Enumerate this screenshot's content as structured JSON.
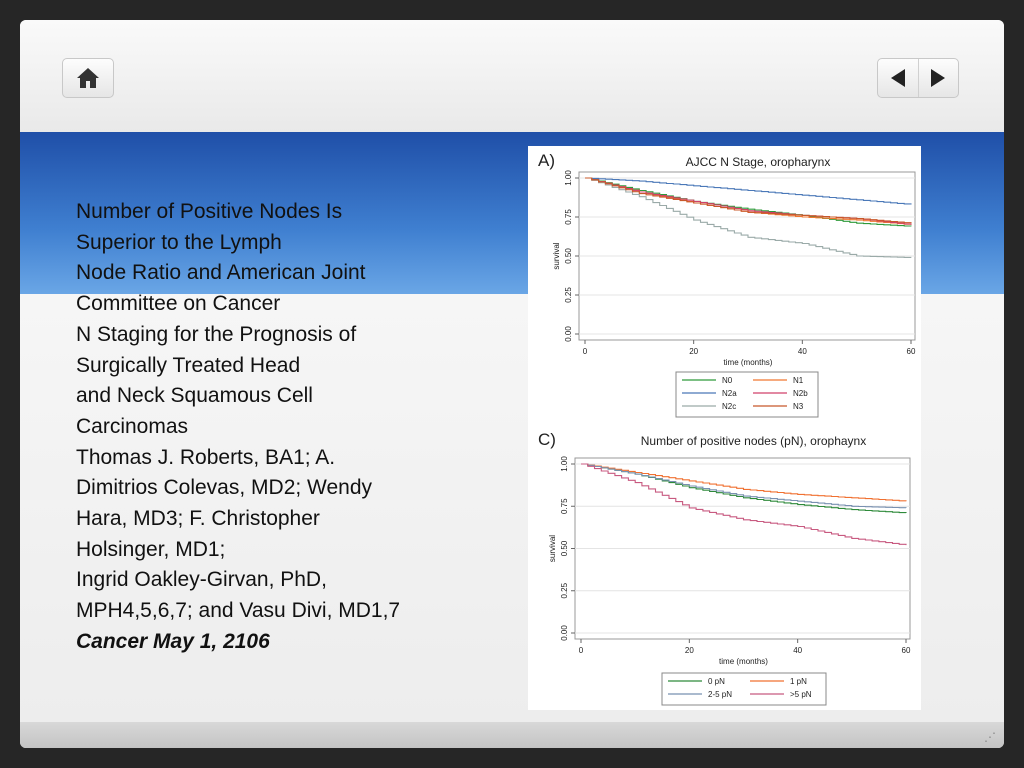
{
  "toolbar": {
    "home_icon": "home-icon",
    "prev_icon": "triangle-left-icon",
    "next_icon": "triangle-right-icon"
  },
  "slide": {
    "title_lines": [
      "Number of Positive Nodes Is",
      "Superior to the Lymph",
      "Node Ratio and American Joint",
      "Committee on Cancer",
      "N Staging for the Prognosis of",
      "Surgically Treated Head",
      "and Neck Squamous Cell",
      "Carcinomas",
      "Thomas J. Roberts, BA1; A.",
      "Dimitrios Colevas, MD2; Wendy",
      "Hara, MD3; F. Christopher",
      "Holsinger, MD1;",
      "Ingrid Oakley-Girvan, PhD,",
      "MPH4,5,6,7; and Vasu Divi, MD1,7"
    ],
    "citation": "Cancer May 1, 2106"
  },
  "chart_data": [
    {
      "panel": "A)",
      "type": "line",
      "title": "AJCC N Stage, oropharynx",
      "xlabel": "time (months)",
      "ylabel": "survival",
      "xlim": [
        0,
        60
      ],
      "ylim": [
        0,
        1
      ],
      "xticks": [
        "0",
        "20",
        "40",
        "60"
      ],
      "yticks": [
        "0.00",
        "0.25",
        "0.50",
        "0.75",
        "1.00"
      ],
      "grid": true,
      "legend": "bottom",
      "x": [
        0,
        10,
        20,
        30,
        40,
        50,
        60
      ],
      "series": [
        {
          "name": "N0",
          "color": "#2e9a3a",
          "values": [
            1,
            0.92,
            0.85,
            0.8,
            0.76,
            0.71,
            0.69
          ]
        },
        {
          "name": "N1",
          "color": "#f07830",
          "values": [
            1,
            0.91,
            0.84,
            0.78,
            0.75,
            0.73,
            0.7
          ]
        },
        {
          "name": "N2a",
          "color": "#4a78b8",
          "values": [
            1,
            0.98,
            0.95,
            0.92,
            0.89,
            0.86,
            0.83
          ]
        },
        {
          "name": "N2b",
          "color": "#d0406a",
          "values": [
            1,
            0.91,
            0.85,
            0.79,
            0.76,
            0.74,
            0.7
          ]
        },
        {
          "name": "N2c",
          "color": "#9aaaa8",
          "values": [
            1,
            0.88,
            0.73,
            0.62,
            0.58,
            0.5,
            0.49
          ]
        },
        {
          "name": "N3",
          "color": "#c8582a",
          "values": [
            1,
            0.9,
            0.84,
            0.78,
            0.76,
            0.74,
            0.71
          ]
        }
      ]
    },
    {
      "panel": "C)",
      "type": "line",
      "title": "Number of positive nodes (pN), orophaynx",
      "xlabel": "time (months)",
      "ylabel": "survival",
      "xlim": [
        0,
        60
      ],
      "ylim": [
        0,
        1
      ],
      "xticks": [
        "0",
        "20",
        "40",
        "60"
      ],
      "yticks": [
        "0.00",
        "0.25",
        "0.50",
        "0.75",
        "1.00"
      ],
      "grid": true,
      "legend": "bottom",
      "x": [
        0,
        10,
        20,
        30,
        40,
        50,
        60
      ],
      "series": [
        {
          "name": "0 pN",
          "color": "#2e8a3a",
          "values": [
            1,
            0.94,
            0.86,
            0.8,
            0.76,
            0.73,
            0.71
          ]
        },
        {
          "name": "1 pN",
          "color": "#f07030",
          "values": [
            1,
            0.95,
            0.9,
            0.85,
            0.82,
            0.8,
            0.78
          ]
        },
        {
          "name": "2-5 pN",
          "color": "#7890b0",
          "values": [
            1,
            0.94,
            0.87,
            0.81,
            0.78,
            0.75,
            0.74
          ]
        },
        {
          "name": ">5 pN",
          "color": "#c85a80",
          "values": [
            1,
            0.89,
            0.74,
            0.67,
            0.63,
            0.56,
            0.52
          ]
        }
      ]
    }
  ]
}
